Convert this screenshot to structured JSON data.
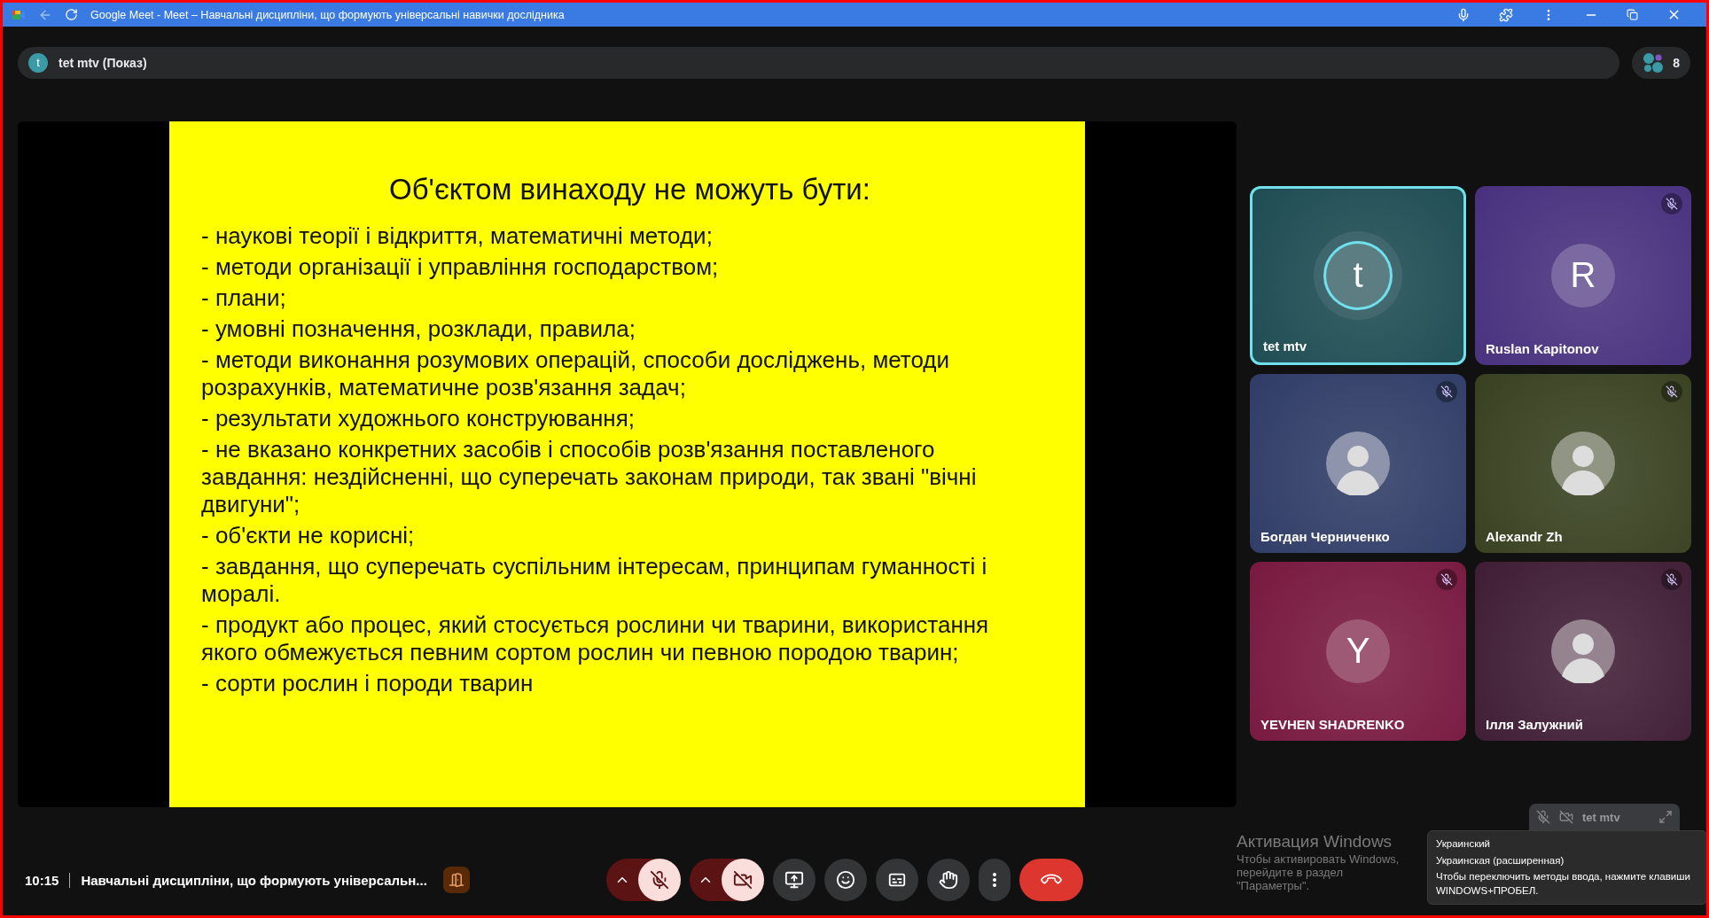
{
  "browser": {
    "title": "Google Meet - Meet – Навчальні дисципліни, що формують універсальні навички дослідника"
  },
  "presenter_bar": {
    "avatar": "t",
    "label": "tet mtv (Показ)"
  },
  "participants_count": "8",
  "slide": {
    "title": "Об'єктом винаходу не можуть бути:",
    "lines": [
      "- наукові теорії і відкриття, математичні методи;",
      "- методи організації і управління господарством;",
      "- плани;",
      "- умовні позначення, розклади, правила;",
      "- методи виконання розумових операцій, способи досліджень, методи розрахунків, математичне розв'язання задач;",
      "- результати художнього конструювання;",
      "- не вказано конкретних засобів і способів розв'язання поставленого завдання: нездійсненні, що суперечать законам природи, так звані \"вічні двигуни\";",
      "- об'єкти не корисні;",
      "- завдання, що суперечать суспільним інтересам, принципам гуманності і моралі.",
      "- продукт або процес, який стосується рослини чи тварини, використання якого обмежується певним сортом рослин чи певною породою тварин;",
      "- сорти рослин і породи тварин"
    ]
  },
  "tiles": [
    {
      "name": "tet mtv",
      "kind": "initial",
      "initial": "t",
      "color": "#1d4c52",
      "muted": false,
      "speaking": true
    },
    {
      "name": "Ruslan Kapitonov",
      "kind": "initial",
      "initial": "R",
      "color": "#48307e",
      "muted": true,
      "speaking": false
    },
    {
      "name": "Богдан Черниченко",
      "kind": "photo",
      "color": "#2f3c66",
      "muted": true,
      "speaking": false
    },
    {
      "name": "Alexandr Zh",
      "kind": "photo",
      "color": "#37401f",
      "muted": true,
      "speaking": false
    },
    {
      "name": "YEVHEN SHADRENKO",
      "kind": "initial",
      "initial": "Y",
      "color": "#78183f",
      "muted": true,
      "speaking": false
    },
    {
      "name": "Ілля Залужний",
      "kind": "photo",
      "color": "#3f1d35",
      "muted": true,
      "speaking": false
    }
  ],
  "self_view": {
    "name": "tet mtv"
  },
  "meeting": {
    "time": "10:15",
    "title": "Навчальні дисципліни, що формують універсальн..."
  },
  "controls": [
    {
      "kind": "mic",
      "on": false
    },
    {
      "kind": "camera",
      "on": false
    },
    {
      "kind": "present"
    },
    {
      "kind": "reactions"
    },
    {
      "kind": "captions"
    },
    {
      "kind": "raise_hand"
    },
    {
      "kind": "more"
    },
    {
      "kind": "leave"
    }
  ],
  "windows_activation": {
    "title": "Активация Windows",
    "text": "Чтобы активировать Windows, перейдите в раздел \"Параметры\"."
  },
  "input_tooltip": {
    "lines": [
      "Украинский",
      "Украинская (расширенная)",
      "Чтобы переключить методы ввода, нажмите клавиши WINDOWS+ПРОБЕЛ."
    ]
  }
}
